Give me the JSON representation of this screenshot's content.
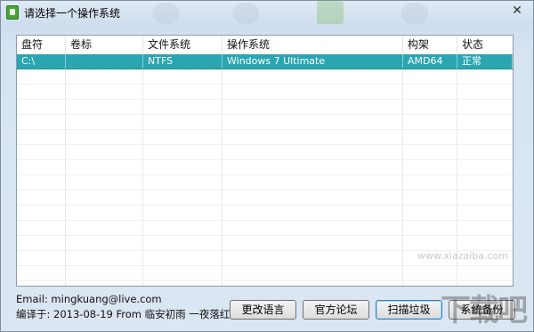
{
  "window": {
    "title": "请选择一个操作系统",
    "close_glyph": "✕"
  },
  "table": {
    "columns": [
      "盘符",
      "卷标",
      "文件系统",
      "操作系统",
      "构架",
      "状态"
    ],
    "rows": [
      [
        "C:\\",
        "",
        "NTFS",
        "Windows 7 Ultimate",
        "AMD64",
        "正常"
      ]
    ],
    "selected_row": 0
  },
  "footer": {
    "email": "Email: mingkuang@live.com",
    "compiled": "编译于: 2013-08-19 From 临安初雨 一夜落红"
  },
  "buttons": {
    "change_language": "更改语言",
    "official_forum": "官方论坛",
    "scan_junk": "扫描垃圾",
    "system_backup": "系统备份"
  },
  "watermark": {
    "text": "下载吧",
    "url": "www.xiazaiba.com"
  },
  "colors": {
    "selection": "#2aa6b1",
    "window_bg": "#d6e4f2"
  }
}
